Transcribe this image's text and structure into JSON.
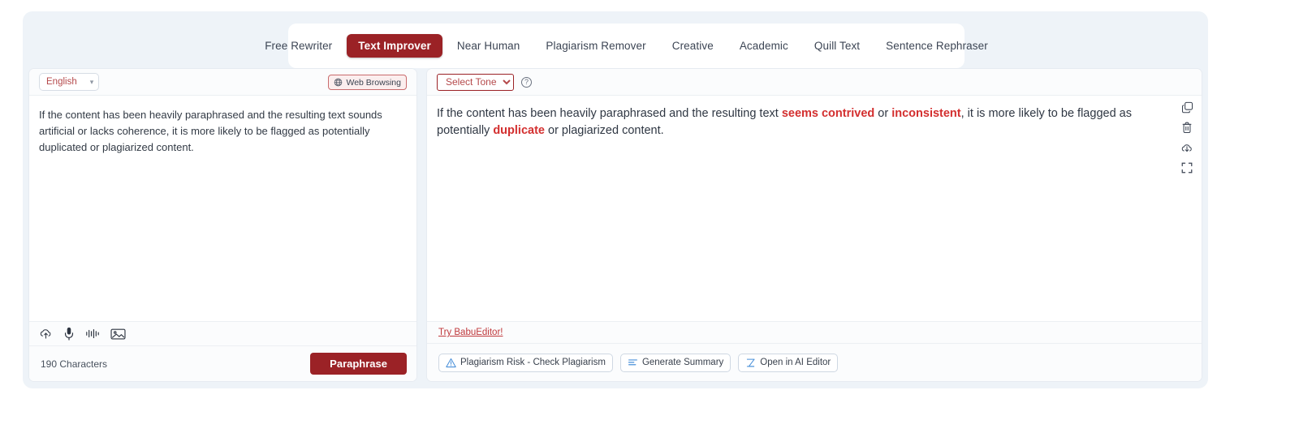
{
  "tabs": [
    {
      "label": "Free Rewriter",
      "active": false
    },
    {
      "label": "Text Improver",
      "active": true
    },
    {
      "label": "Near Human",
      "active": false
    },
    {
      "label": "Plagiarism Remover",
      "active": false
    },
    {
      "label": "Creative",
      "active": false
    },
    {
      "label": "Academic",
      "active": false
    },
    {
      "label": "Quill Text",
      "active": false
    },
    {
      "label": "Sentence Rephraser",
      "active": false
    }
  ],
  "left_panel": {
    "language_value": "English",
    "language_chevron": "chevron-down-icon",
    "web_browsing_label": "Web Browsing",
    "web_browsing_icon": "globe-icon",
    "input_text": "If the content has been heavily paraphrased and the resulting text sounds artificial or lacks coherence, it is more likely to be flagged as potentially duplicated or plagiarized content.",
    "tools": [
      {
        "name": "upload-cloud-icon"
      },
      {
        "name": "microphone-icon"
      },
      {
        "name": "audio-waveform-icon"
      },
      {
        "name": "image-icon"
      }
    ],
    "character_count": "190 Characters",
    "paraphrase_label": "Paraphrase"
  },
  "right_panel": {
    "tone_value": "Select Tone",
    "tone_options": [
      "Select Tone"
    ],
    "help_icon": "question-circle-icon",
    "output_segments": [
      {
        "text": "If the content has been heavily paraphrased and the resulting text ",
        "highlight": false
      },
      {
        "text": "seems contrived",
        "highlight": true
      },
      {
        "text": " or ",
        "highlight": false
      },
      {
        "text": "inconsistent",
        "highlight": true
      },
      {
        "text": ", it is more likely to be flagged as potentially ",
        "highlight": false
      },
      {
        "text": "duplicate",
        "highlight": true
      },
      {
        "text": " or plagiarized content.",
        "highlight": false
      }
    ],
    "rail_icons": [
      {
        "name": "copy-icon"
      },
      {
        "name": "trash-icon"
      },
      {
        "name": "download-cloud-icon"
      },
      {
        "name": "fullscreen-icon"
      }
    ],
    "try_editor_label": "Try BabuEditor!",
    "actions": [
      {
        "label": "Plagiarism Risk - Check Plagiarism",
        "icon": "warning-triangle-icon"
      },
      {
        "label": "Generate Summary",
        "icon": "summary-lines-icon"
      },
      {
        "label": "Open in AI Editor",
        "icon": "ai-editor-icon"
      }
    ]
  },
  "colors": {
    "brand_red": "#9b2226",
    "highlight_red": "#d32f2f",
    "panel_bg": "#ffffff",
    "app_bg": "#eef3f8",
    "accent_blue": "#4a90d9"
  }
}
